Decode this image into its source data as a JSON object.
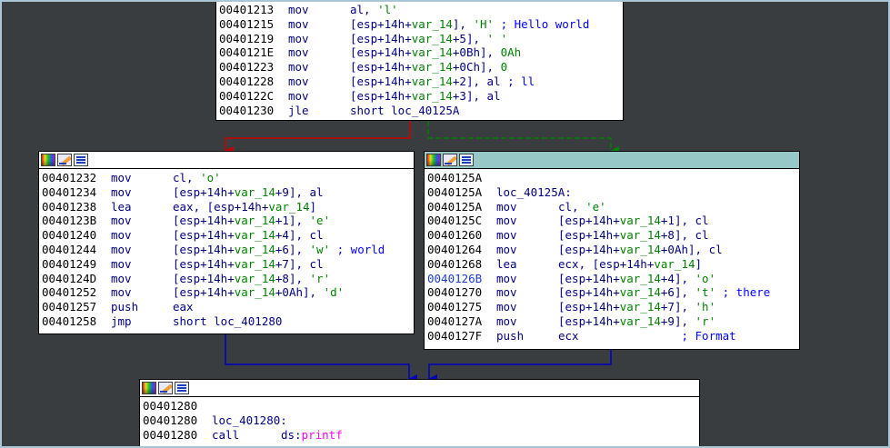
{
  "colors": {
    "background": "#3a3d40",
    "edge_false": "#cc0000",
    "edge_true": "#008000",
    "edge_uncond": "#0000c0",
    "active_header": "#96c8c8"
  },
  "nodes": {
    "top": {
      "lines": [
        {
          "addr": "00401213",
          "mn": "mov",
          "ops": [
            {
              "t": "al, "
            },
            {
              "t": "'l'",
              "c": "imm"
            }
          ]
        },
        {
          "addr": "00401215",
          "mn": "mov",
          "ops": [
            {
              "t": "[esp+14h+"
            },
            {
              "t": "var_14",
              "c": "var"
            },
            {
              "t": "], "
            },
            {
              "t": "'H'",
              "c": "imm"
            },
            {
              "t": " ; Hello world",
              "c": "cmt"
            }
          ]
        },
        {
          "addr": "00401219",
          "mn": "mov",
          "ops": [
            {
              "t": "[esp+14h+"
            },
            {
              "t": "var_14",
              "c": "var"
            },
            {
              "t": "+5], "
            },
            {
              "t": "' '",
              "c": "imm"
            }
          ]
        },
        {
          "addr": "0040121E",
          "mn": "mov",
          "ops": [
            {
              "t": "[esp+14h+"
            },
            {
              "t": "var_14",
              "c": "var"
            },
            {
              "t": "+0Bh], "
            },
            {
              "t": "0Ah",
              "c": "imm"
            }
          ]
        },
        {
          "addr": "00401223",
          "mn": "mov",
          "ops": [
            {
              "t": "[esp+14h+"
            },
            {
              "t": "var_14",
              "c": "var"
            },
            {
              "t": "+0Ch], "
            },
            {
              "t": "0",
              "c": "imm"
            }
          ]
        },
        {
          "addr": "00401228",
          "mn": "mov",
          "ops": [
            {
              "t": "[esp+14h+"
            },
            {
              "t": "var_14",
              "c": "var"
            },
            {
              "t": "+2], al"
            },
            {
              "t": " ; ll",
              "c": "cmt"
            }
          ]
        },
        {
          "addr": "0040122C",
          "mn": "mov",
          "ops": [
            {
              "t": "[esp+14h+"
            },
            {
              "t": "var_14",
              "c": "var"
            },
            {
              "t": "+3], al"
            }
          ]
        },
        {
          "addr": "00401230",
          "mn": "jle",
          "ops": [
            {
              "t": "short loc_40125A"
            }
          ]
        }
      ]
    },
    "left": {
      "lines": [
        {
          "addr": "00401232",
          "mn": "mov",
          "ops": [
            {
              "t": "cl, "
            },
            {
              "t": "'o'",
              "c": "imm"
            }
          ]
        },
        {
          "addr": "00401234",
          "mn": "mov",
          "ops": [
            {
              "t": "[esp+14h+"
            },
            {
              "t": "var_14",
              "c": "var"
            },
            {
              "t": "+9], al"
            }
          ]
        },
        {
          "addr": "00401238",
          "mn": "lea",
          "ops": [
            {
              "t": "eax, [esp+14h+"
            },
            {
              "t": "var_14",
              "c": "var"
            },
            {
              "t": "]"
            }
          ]
        },
        {
          "addr": "0040123B",
          "mn": "mov",
          "ops": [
            {
              "t": "[esp+14h+"
            },
            {
              "t": "var_14",
              "c": "var"
            },
            {
              "t": "+1], "
            },
            {
              "t": "'e'",
              "c": "imm"
            }
          ]
        },
        {
          "addr": "00401240",
          "mn": "mov",
          "ops": [
            {
              "t": "[esp+14h+"
            },
            {
              "t": "var_14",
              "c": "var"
            },
            {
              "t": "+4], cl"
            }
          ]
        },
        {
          "addr": "00401244",
          "mn": "mov",
          "ops": [
            {
              "t": "[esp+14h+"
            },
            {
              "t": "var_14",
              "c": "var"
            },
            {
              "t": "+6], "
            },
            {
              "t": "'w'",
              "c": "imm"
            },
            {
              "t": " ; world",
              "c": "cmt"
            }
          ]
        },
        {
          "addr": "00401249",
          "mn": "mov",
          "ops": [
            {
              "t": "[esp+14h+"
            },
            {
              "t": "var_14",
              "c": "var"
            },
            {
              "t": "+7], cl"
            }
          ]
        },
        {
          "addr": "0040124D",
          "mn": "mov",
          "ops": [
            {
              "t": "[esp+14h+"
            },
            {
              "t": "var_14",
              "c": "var"
            },
            {
              "t": "+8], "
            },
            {
              "t": "'r'",
              "c": "imm"
            }
          ]
        },
        {
          "addr": "00401252",
          "mn": "mov",
          "ops": [
            {
              "t": "[esp+14h+"
            },
            {
              "t": "var_14",
              "c": "var"
            },
            {
              "t": "+0Ah], "
            },
            {
              "t": "'d'",
              "c": "imm"
            }
          ]
        },
        {
          "addr": "00401257",
          "mn": "push",
          "ops": [
            {
              "t": "eax"
            }
          ]
        },
        {
          "addr": "00401258",
          "mn": "jmp",
          "ops": [
            {
              "t": "short loc_401280"
            }
          ]
        }
      ]
    },
    "right": {
      "lines": [
        {
          "addr": "0040125A",
          "mn": "",
          "ops": []
        },
        {
          "addr": "0040125A",
          "label": "loc_40125A:"
        },
        {
          "addr": "0040125A",
          "mn": "mov",
          "ops": [
            {
              "t": "cl, "
            },
            {
              "t": "'e'",
              "c": "imm"
            }
          ]
        },
        {
          "addr": "0040125C",
          "mn": "mov",
          "ops": [
            {
              "t": "[esp+14h+"
            },
            {
              "t": "var_14",
              "c": "var"
            },
            {
              "t": "+1], cl"
            }
          ]
        },
        {
          "addr": "00401260",
          "mn": "mov",
          "ops": [
            {
              "t": "[esp+14h+"
            },
            {
              "t": "var_14",
              "c": "var"
            },
            {
              "t": "+8], cl"
            }
          ]
        },
        {
          "addr": "00401264",
          "mn": "mov",
          "ops": [
            {
              "t": "[esp+14h+"
            },
            {
              "t": "var_14",
              "c": "var"
            },
            {
              "t": "+0Ah], cl"
            }
          ]
        },
        {
          "addr": "00401268",
          "mn": "lea",
          "ops": [
            {
              "t": "ecx, [esp+14h+"
            },
            {
              "t": "var_14",
              "c": "var"
            },
            {
              "t": "]"
            }
          ]
        },
        {
          "addr": "0040126B",
          "hl": true,
          "mn": "mov",
          "ops": [
            {
              "t": "[esp+14h+"
            },
            {
              "t": "var_14",
              "c": "var"
            },
            {
              "t": "+4], "
            },
            {
              "t": "'o'",
              "c": "imm"
            }
          ]
        },
        {
          "addr": "00401270",
          "mn": "mov",
          "ops": [
            {
              "t": "[esp+14h+"
            },
            {
              "t": "var_14",
              "c": "var"
            },
            {
              "t": "+6], "
            },
            {
              "t": "'t'",
              "c": "imm"
            },
            {
              "t": " ; there",
              "c": "cmt"
            }
          ]
        },
        {
          "addr": "00401275",
          "mn": "mov",
          "ops": [
            {
              "t": "[esp+14h+"
            },
            {
              "t": "var_14",
              "c": "var"
            },
            {
              "t": "+7], "
            },
            {
              "t": "'h'",
              "c": "imm"
            }
          ]
        },
        {
          "addr": "0040127A",
          "mn": "mov",
          "ops": [
            {
              "t": "[esp+14h+"
            },
            {
              "t": "var_14",
              "c": "var"
            },
            {
              "t": "+9], "
            },
            {
              "t": "'r'",
              "c": "imm"
            }
          ]
        },
        {
          "addr": "0040127F",
          "mn": "push",
          "ops": [
            {
              "t": "ecx"
            },
            {
              "t": "               ; Format",
              "c": "cmt"
            }
          ]
        }
      ]
    },
    "bottom": {
      "lines": [
        {
          "addr": "00401280",
          "mn": "",
          "ops": []
        },
        {
          "addr": "00401280",
          "label": "loc_401280:"
        },
        {
          "addr": "00401280",
          "mn": "call",
          "ops": [
            {
              "t": "ds:"
            },
            {
              "t": "printf",
              "c": "func"
            }
          ]
        }
      ]
    }
  }
}
